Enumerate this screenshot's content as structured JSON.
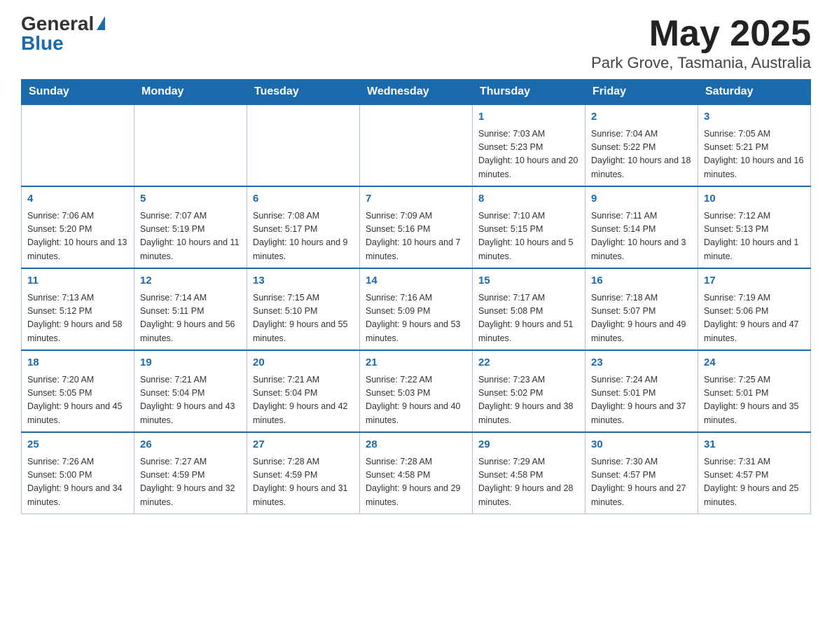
{
  "header": {
    "logo_general": "General",
    "logo_blue": "Blue",
    "title": "May 2025",
    "subtitle": "Park Grove, Tasmania, Australia"
  },
  "calendar": {
    "days_of_week": [
      "Sunday",
      "Monday",
      "Tuesday",
      "Wednesday",
      "Thursday",
      "Friday",
      "Saturday"
    ],
    "weeks": [
      {
        "cells": [
          {
            "day": null,
            "info": null
          },
          {
            "day": null,
            "info": null
          },
          {
            "day": null,
            "info": null
          },
          {
            "day": null,
            "info": null
          },
          {
            "day": "1",
            "info": "Sunrise: 7:03 AM\nSunset: 5:23 PM\nDaylight: 10 hours and 20 minutes."
          },
          {
            "day": "2",
            "info": "Sunrise: 7:04 AM\nSunset: 5:22 PM\nDaylight: 10 hours and 18 minutes."
          },
          {
            "day": "3",
            "info": "Sunrise: 7:05 AM\nSunset: 5:21 PM\nDaylight: 10 hours and 16 minutes."
          }
        ]
      },
      {
        "cells": [
          {
            "day": "4",
            "info": "Sunrise: 7:06 AM\nSunset: 5:20 PM\nDaylight: 10 hours and 13 minutes."
          },
          {
            "day": "5",
            "info": "Sunrise: 7:07 AM\nSunset: 5:19 PM\nDaylight: 10 hours and 11 minutes."
          },
          {
            "day": "6",
            "info": "Sunrise: 7:08 AM\nSunset: 5:17 PM\nDaylight: 10 hours and 9 minutes."
          },
          {
            "day": "7",
            "info": "Sunrise: 7:09 AM\nSunset: 5:16 PM\nDaylight: 10 hours and 7 minutes."
          },
          {
            "day": "8",
            "info": "Sunrise: 7:10 AM\nSunset: 5:15 PM\nDaylight: 10 hours and 5 minutes."
          },
          {
            "day": "9",
            "info": "Sunrise: 7:11 AM\nSunset: 5:14 PM\nDaylight: 10 hours and 3 minutes."
          },
          {
            "day": "10",
            "info": "Sunrise: 7:12 AM\nSunset: 5:13 PM\nDaylight: 10 hours and 1 minute."
          }
        ]
      },
      {
        "cells": [
          {
            "day": "11",
            "info": "Sunrise: 7:13 AM\nSunset: 5:12 PM\nDaylight: 9 hours and 58 minutes."
          },
          {
            "day": "12",
            "info": "Sunrise: 7:14 AM\nSunset: 5:11 PM\nDaylight: 9 hours and 56 minutes."
          },
          {
            "day": "13",
            "info": "Sunrise: 7:15 AM\nSunset: 5:10 PM\nDaylight: 9 hours and 55 minutes."
          },
          {
            "day": "14",
            "info": "Sunrise: 7:16 AM\nSunset: 5:09 PM\nDaylight: 9 hours and 53 minutes."
          },
          {
            "day": "15",
            "info": "Sunrise: 7:17 AM\nSunset: 5:08 PM\nDaylight: 9 hours and 51 minutes."
          },
          {
            "day": "16",
            "info": "Sunrise: 7:18 AM\nSunset: 5:07 PM\nDaylight: 9 hours and 49 minutes."
          },
          {
            "day": "17",
            "info": "Sunrise: 7:19 AM\nSunset: 5:06 PM\nDaylight: 9 hours and 47 minutes."
          }
        ]
      },
      {
        "cells": [
          {
            "day": "18",
            "info": "Sunrise: 7:20 AM\nSunset: 5:05 PM\nDaylight: 9 hours and 45 minutes."
          },
          {
            "day": "19",
            "info": "Sunrise: 7:21 AM\nSunset: 5:04 PM\nDaylight: 9 hours and 43 minutes."
          },
          {
            "day": "20",
            "info": "Sunrise: 7:21 AM\nSunset: 5:04 PM\nDaylight: 9 hours and 42 minutes."
          },
          {
            "day": "21",
            "info": "Sunrise: 7:22 AM\nSunset: 5:03 PM\nDaylight: 9 hours and 40 minutes."
          },
          {
            "day": "22",
            "info": "Sunrise: 7:23 AM\nSunset: 5:02 PM\nDaylight: 9 hours and 38 minutes."
          },
          {
            "day": "23",
            "info": "Sunrise: 7:24 AM\nSunset: 5:01 PM\nDaylight: 9 hours and 37 minutes."
          },
          {
            "day": "24",
            "info": "Sunrise: 7:25 AM\nSunset: 5:01 PM\nDaylight: 9 hours and 35 minutes."
          }
        ]
      },
      {
        "cells": [
          {
            "day": "25",
            "info": "Sunrise: 7:26 AM\nSunset: 5:00 PM\nDaylight: 9 hours and 34 minutes."
          },
          {
            "day": "26",
            "info": "Sunrise: 7:27 AM\nSunset: 4:59 PM\nDaylight: 9 hours and 32 minutes."
          },
          {
            "day": "27",
            "info": "Sunrise: 7:28 AM\nSunset: 4:59 PM\nDaylight: 9 hours and 31 minutes."
          },
          {
            "day": "28",
            "info": "Sunrise: 7:28 AM\nSunset: 4:58 PM\nDaylight: 9 hours and 29 minutes."
          },
          {
            "day": "29",
            "info": "Sunrise: 7:29 AM\nSunset: 4:58 PM\nDaylight: 9 hours and 28 minutes."
          },
          {
            "day": "30",
            "info": "Sunrise: 7:30 AM\nSunset: 4:57 PM\nDaylight: 9 hours and 27 minutes."
          },
          {
            "day": "31",
            "info": "Sunrise: 7:31 AM\nSunset: 4:57 PM\nDaylight: 9 hours and 25 minutes."
          }
        ]
      }
    ]
  }
}
